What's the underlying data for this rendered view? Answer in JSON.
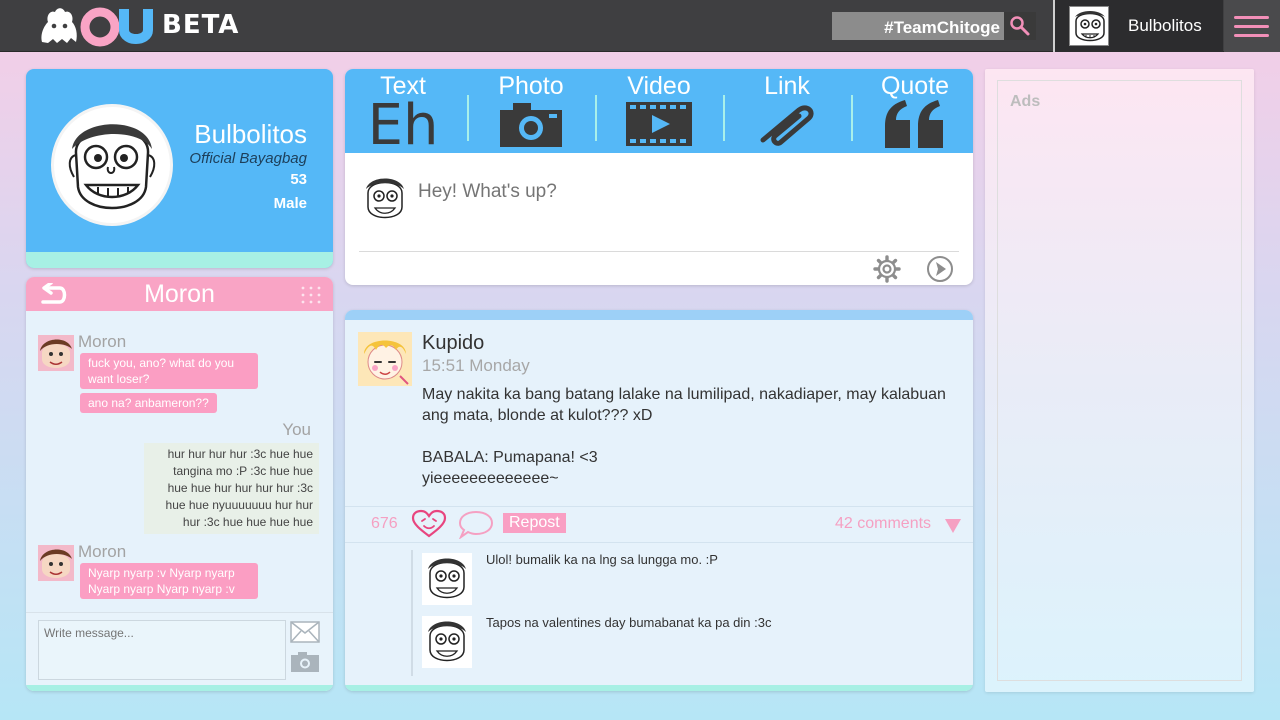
{
  "app": {
    "logo_suffix": "BETA",
    "search": {
      "value": "#TeamChitoge"
    },
    "user": {
      "name": "Bulbolitos"
    }
  },
  "profile": {
    "name": "Bulbolitos",
    "title": "Official Bayagbag",
    "age": "53",
    "gender": "Male"
  },
  "chat": {
    "title": "Moron",
    "messages": [
      {
        "sender": "Moron",
        "lines": [
          "fuck you, ano? what do you want loser?",
          "ano na? anbameron??"
        ]
      },
      {
        "sender": "You",
        "text": "hur hur hur hur :3c hue hue tangina mo :P :3c hue hue hue hue hur hur hur hur :3c hue hue nyuuuuuuu hur hur hur :3c hue hue hue hue"
      },
      {
        "sender": "Moron",
        "lines": [
          "Nyarp nyarp :v Nyarp nyarp Nyarp nyarp Nyarp nyarp :v"
        ]
      }
    ],
    "input_placeholder": "Write message..."
  },
  "composer": {
    "post_types": [
      "Text",
      "Photo",
      "Video",
      "Link",
      "Quote"
    ],
    "text_icon_label": "Eh",
    "placeholder": "Hey! What's up?"
  },
  "post": {
    "author": "Kupido",
    "time": "15:51 Monday",
    "body_lines": [
      "May nakita ka bang batang lalake na lumilipad, nakadiaper, may kalabuan ang mata, blonde at kulot??? xD",
      "",
      "BABALA: Pumapana! <3",
      "yieeeeeeeeeeeee~"
    ],
    "likes": "676",
    "repost_label": "Repost",
    "comments_label": "42 comments",
    "comments": [
      {
        "text": "Ulol! bumalik ka na lng sa lungga mo. :P"
      },
      {
        "text": "Tapos na valentines day bumabanat ka pa din :3c"
      }
    ]
  },
  "ads": {
    "label": "Ads"
  },
  "colors": {
    "topbar": "#3f3f41",
    "blue": "#55b8f7",
    "pink": "#f99fc3",
    "mint": "#a7f0e4"
  }
}
